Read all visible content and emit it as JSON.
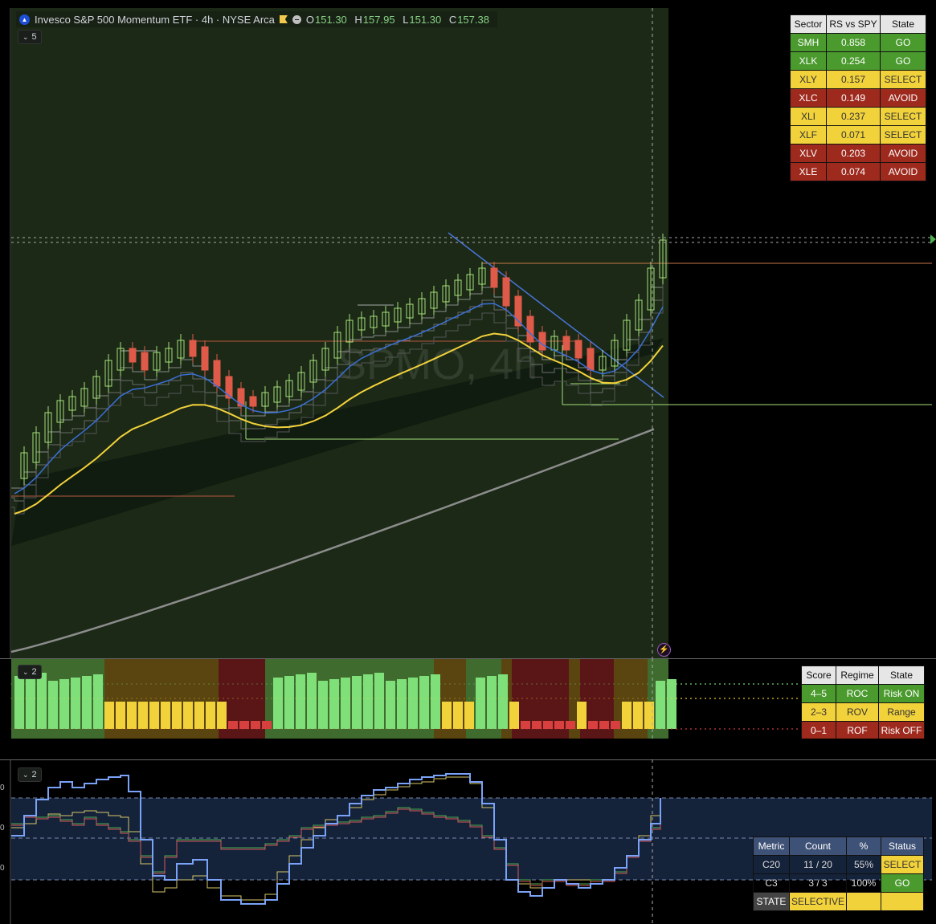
{
  "header": {
    "symbol_title": "Invesco S&P 500 Momentum ETF · 4h · NYSE Arca",
    "ohlc": [
      {
        "k": "O",
        "v": "151.30"
      },
      {
        "k": "H",
        "v": "157.95"
      },
      {
        "k": "L",
        "v": "151.30"
      },
      {
        "k": "C",
        "v": "157.38"
      }
    ],
    "indicator_count": "5"
  },
  "watermark": "SPMO, 4h",
  "sector_table": {
    "headers": [
      "Sector",
      "RS vs SPY",
      "State"
    ],
    "rows": [
      [
        "SMH",
        "0.858",
        "GO"
      ],
      [
        "XLK",
        "0.254",
        "GO"
      ],
      [
        "XLY",
        "0.157",
        "SELECT"
      ],
      [
        "XLC",
        "0.149",
        "AVOID"
      ],
      [
        "XLI",
        "0.237",
        "SELECT"
      ],
      [
        "XLF",
        "0.071",
        "SELECT"
      ],
      [
        "XLV",
        "0.203",
        "AVOID"
      ],
      [
        "XLE",
        "0.074",
        "AVOID"
      ]
    ],
    "state_colors": {
      "GO": "#4a9a2e",
      "SELECT": "#f2d23b",
      "AVOID": "#9e2a1e"
    }
  },
  "regime_pane": {
    "indicator_count": "2",
    "headers": [
      "Score",
      "Regime",
      "State"
    ],
    "rows": [
      [
        "4–5",
        "ROC",
        "Risk ON"
      ],
      [
        "2–3",
        "ROV",
        "Range"
      ],
      [
        "0–1",
        "ROF",
        "Risk OFF"
      ]
    ]
  },
  "breadth_pane": {
    "indicator_count": "2",
    "headers": [
      "Metric",
      "Count",
      "%",
      "Status"
    ],
    "rows": [
      [
        "C20",
        "11 / 20",
        "55%",
        "SELECT"
      ],
      [
        "C3",
        "3 / 3",
        "100%",
        "GO"
      ]
    ],
    "state_row": [
      "STATE",
      "SELECTIVE"
    ],
    "y_ticks": [
      "0",
      "0",
      "0"
    ]
  },
  "icons": [
    "logo-icon",
    "flag-icon",
    "status-dot-icon",
    "chevron-down-icon",
    "lightning-icon",
    "price-marker-icon"
  ],
  "colors": {
    "up_candle": "#a6e07a",
    "down_candle": "#e05a4a",
    "ema_fast": "#3b6fd8",
    "ema_mid": "#f2d23b",
    "sma_long": "#8c8c8c",
    "regime_green": "#4a9a2e",
    "regime_yellow": "#f2d23b",
    "regime_red": "#9e2a1e"
  }
}
